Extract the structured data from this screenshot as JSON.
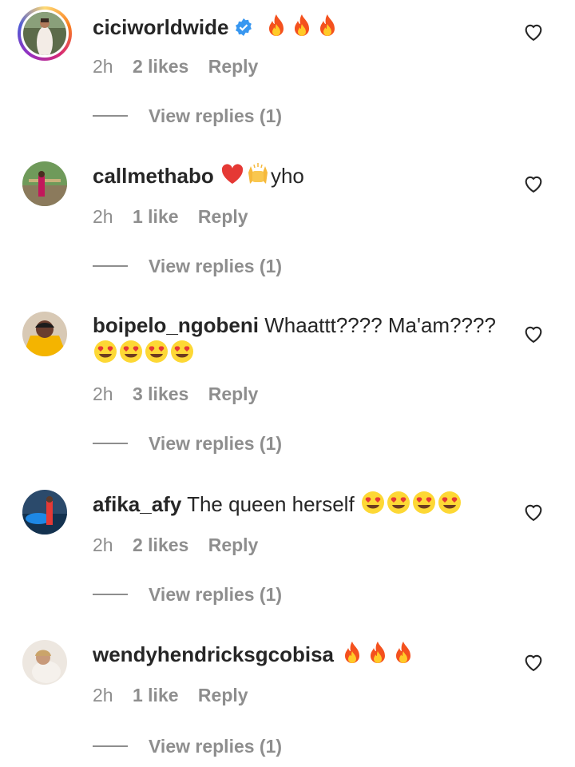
{
  "comments": [
    {
      "username": "ciciworldwide",
      "verified": true,
      "text": "",
      "emojis": [
        "fire",
        "fire",
        "fire"
      ],
      "emojis_line2": [],
      "time": "2h",
      "likes": "2 likes",
      "reply": "Reply",
      "view_replies": "View replies (1)"
    },
    {
      "username": "callmethabo",
      "verified": false,
      "text": "yho",
      "emojis": [
        "red-heart",
        "raising-hands"
      ],
      "emojis_line2": [],
      "time": "2h",
      "likes": "1 like",
      "reply": "Reply",
      "view_replies": "View replies (1)"
    },
    {
      "username": "boipelo_ngobeni",
      "verified": false,
      "text": "Whaattt???? Ma'am????",
      "emojis": [],
      "emojis_line2": [
        "heart-eyes",
        "heart-eyes",
        "heart-eyes",
        "heart-eyes"
      ],
      "time": "2h",
      "likes": "3 likes",
      "reply": "Reply",
      "view_replies": "View replies (1)"
    },
    {
      "username": "afika_afy",
      "verified": false,
      "text": "The queen herself",
      "emojis": [
        "heart-eyes",
        "heart-eyes",
        "heart-eyes",
        "heart-eyes"
      ],
      "emojis_line2": [],
      "time": "2h",
      "likes": "2 likes",
      "reply": "Reply",
      "view_replies": "View replies (1)"
    },
    {
      "username": "wendyhendricksgcobisa",
      "verified": false,
      "text": "",
      "emojis": [
        "fire",
        "fire",
        "fire"
      ],
      "emojis_line2": [],
      "time": "2h",
      "likes": "1 like",
      "reply": "Reply",
      "view_replies": "View replies (1)"
    }
  ],
  "icons": {
    "like": "heart-outline-icon",
    "verified": "verified-badge-icon"
  },
  "colors": {
    "text": "#262626",
    "secondary": "#8e8e8e",
    "verified": "#3897f0"
  }
}
